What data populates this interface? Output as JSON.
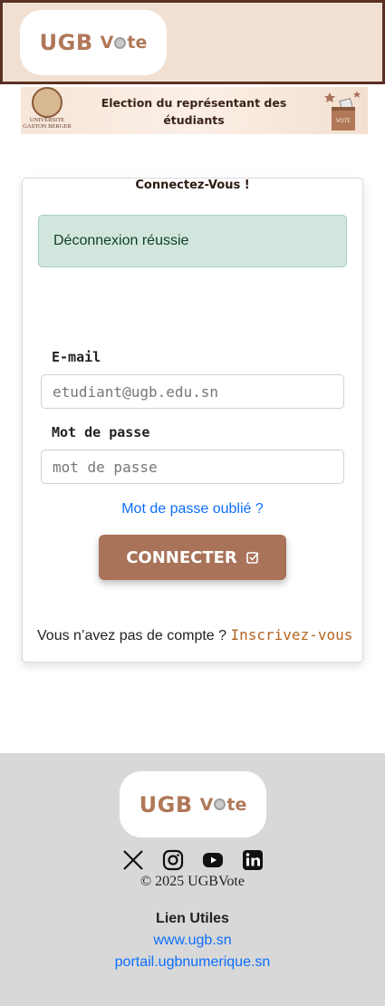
{
  "header": {
    "logo_main": "UGB",
    "logo_sub_before": "V",
    "logo_sub_after": "te"
  },
  "banner": {
    "seal_text": "UNIVERSITE GASTON BERGER",
    "title": "Election du représentant des étudiants",
    "box_label": "VOTE"
  },
  "login": {
    "title": "Connectez-Vous !",
    "alert": "Déconnexion réussie",
    "email_label": "E-mail",
    "email_placeholder": "etudiant@ugb.edu.sn",
    "password_label": "Mot de passe",
    "password_placeholder": "mot de passe",
    "forgot": "Mot de passe oublié ?",
    "submit": "CONNECTER",
    "no_account": "Vous n’avez pas de compte ?",
    "signup": "Inscrivez-vous"
  },
  "footer": {
    "logo_main": "UGB",
    "logo_sub_before": "V",
    "logo_sub_after": "te",
    "socials": [
      "x-icon",
      "instagram-icon",
      "youtube-icon",
      "linkedin-icon"
    ],
    "copyright": "© 2025 UGBVote",
    "links_title": "Lien Utiles",
    "links": [
      "www.ugb.sn",
      "portail.ugbnumerique.sn"
    ]
  },
  "colors": {
    "header_bg": "#f1e0d1",
    "header_border": "#5a3022",
    "brand": "#b07858",
    "button": "#a9735a",
    "alert_bg": "#d1e7dd",
    "link": "#0d6efd",
    "signup_link": "#b5651d",
    "footer_bg": "#d8d8d8"
  }
}
